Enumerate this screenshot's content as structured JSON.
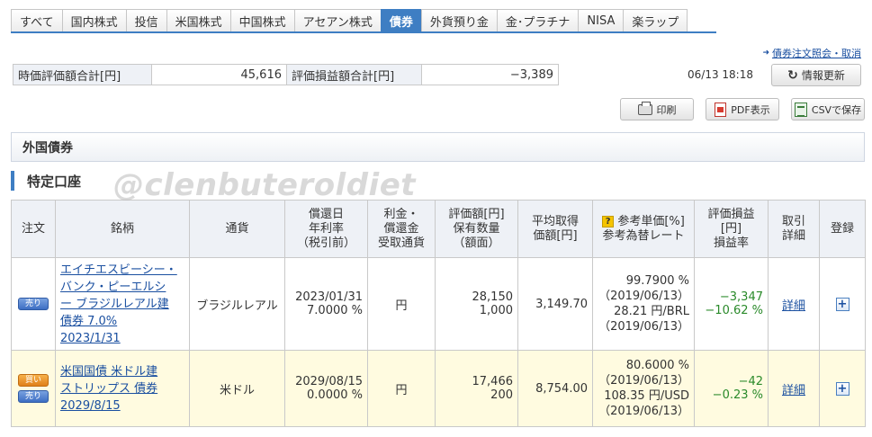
{
  "tabs": [
    {
      "label": "すべて"
    },
    {
      "label": "国内株式"
    },
    {
      "label": "投信"
    },
    {
      "label": "米国株式"
    },
    {
      "label": "中国株式"
    },
    {
      "label": "アセアン株式"
    },
    {
      "label": "債券",
      "active": true
    },
    {
      "label": "外貨預り金"
    },
    {
      "label": "金･プラチナ"
    },
    {
      "label": "NISA"
    },
    {
      "label": "楽ラップ"
    }
  ],
  "top_link": "債券注文照会・取消",
  "summary": {
    "market_value_label": "時価評価額合計[円]",
    "market_value": "45,616",
    "pl_label": "評価損益額合計[円]",
    "pl_value": "−3,389"
  },
  "timestamp": "06/13 18:18",
  "refresh_label": "情報更新",
  "buttons": {
    "print": "印刷",
    "pdf": "PDF表示",
    "csv": "CSVで保存"
  },
  "section_title": "外国債券",
  "account_label": "特定口座",
  "watermark": "@clenbuteroldiet",
  "table": {
    "headers": {
      "order": "注文",
      "name": "銘柄",
      "currency": "通貨",
      "maturity_l1": "償還日",
      "maturity_l2": "年利率",
      "maturity_l3": "（税引前）",
      "recv_l1": "利金・",
      "recv_l2": "償還金",
      "recv_l3": "受取通貨",
      "valuation_l1": "評価額[円]",
      "valuation_l2": "保有数量",
      "valuation_l3": "（額面）",
      "avg_l1": "平均取得",
      "avg_l2": "価額[円]",
      "ref_l1": "参考単価[%]",
      "ref_l2": "参考為替レート",
      "pl_l1": "評価損益",
      "pl_l2": "[円]",
      "pl_l3": "損益率",
      "trade_l1": "取引",
      "trade_l2": "詳細",
      "register": "登録"
    },
    "rows": [
      {
        "badges": [
          "売り"
        ],
        "name_lines": [
          "エイチエスビーシー・",
          "バンク・ピーエルシ",
          "ー ブラジルレアル建",
          "債券 7.0%"
        ],
        "name_date": "2023/1/31",
        "currency": "ブラジルレアル",
        "maturity": "2023/01/31",
        "rate": "7.0000 %",
        "recv_currency": "円",
        "valuation": "28,150",
        "quantity": "1,000",
        "avg_price": "3,149.70",
        "ref_price": "99.7900 %",
        "ref_price_date": "（2019/06/13）",
        "fx_rate": "28.21 円/BRL",
        "fx_date": "（2019/06/13）",
        "pl": "−3,347",
        "pl_rate": "−10.62 %",
        "detail": "詳細",
        "register": "+"
      },
      {
        "badges": [
          "買い",
          "売り"
        ],
        "name_lines": [
          "米国国債 米ドル建",
          "ストリップス 債券"
        ],
        "name_date": "2029/8/15",
        "currency": "米ドル",
        "maturity": "2029/08/15",
        "rate": "0.0000 %",
        "recv_currency": "円",
        "valuation": "17,466",
        "quantity": "200",
        "avg_price": "8,754.00",
        "ref_price": "80.6000 %",
        "ref_price_date": "（2019/06/13）",
        "fx_rate": "108.35 円/USD",
        "fx_date": "（2019/06/13）",
        "pl": "−42",
        "pl_rate": "−0.23 %",
        "detail": "詳細",
        "register": "+"
      }
    ]
  }
}
